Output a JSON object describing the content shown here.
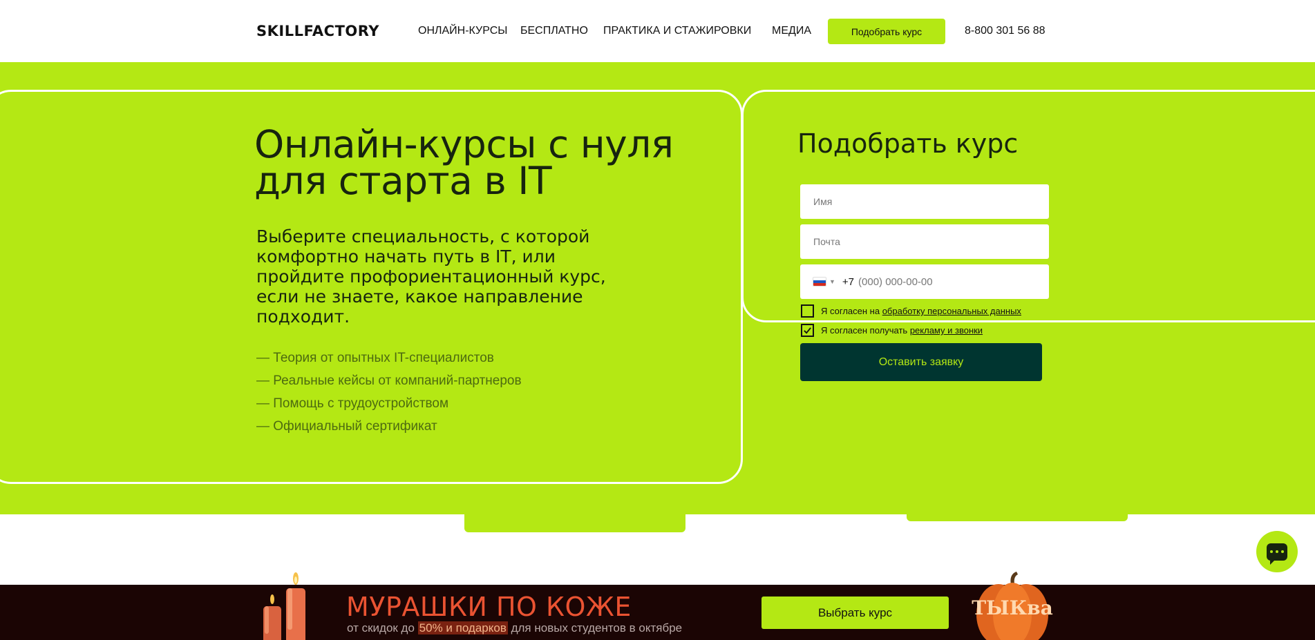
{
  "header": {
    "logo": "SKILLFACTORY",
    "nav": [
      "ОНЛАЙН-КУРСЫ",
      "БЕСПЛАТНО",
      "ПРАКТИКА И СТАЖИРОВКИ",
      "МЕДИА"
    ],
    "cta_label": "Подобрать курс",
    "phone": "8-800 301 56 88"
  },
  "hero": {
    "title": "Онлайн-курсы с нуля\nдля старта в IT",
    "subtitle": "Выберите специальность, с которой комфортно начать путь в IT, или пройдите профориентационный курс, если не знаете, какое направление подходит.",
    "features": [
      "— Теория от опытных IT-специалистов",
      "— Реальные кейсы от компаний-партнеров",
      "— Помощь с трудоустройством",
      "— Официальный сертификат"
    ]
  },
  "form": {
    "title": "Подобрать курс",
    "name_placeholder": "Имя",
    "email_placeholder": "Почта",
    "phone_prefix": "+7",
    "phone_placeholder": "(000) 000-00-00",
    "consent_1_text": "Я согласен на ",
    "consent_1_link": "обработку персональных данных",
    "consent_1_checked": false,
    "consent_2_text": "Я согласен получать ",
    "consent_2_link": "рекламу и звонки",
    "consent_2_checked": true,
    "submit_label": "Оставить заявку"
  },
  "promo": {
    "title": "МУРАШКИ ПО КОЖЕ",
    "sub_before": "от скидок до ",
    "sub_highlight": "50% и подарков",
    "sub_after": " для новых студентов в октябре",
    "button_label": "Выбрать курс",
    "pumpkin_text": "ТЫКва"
  },
  "colors": {
    "accent": "#b4e814",
    "dark_button": "#003530",
    "promo_bg": "#1b0504",
    "promo_title": "#ea5332"
  },
  "icons": {
    "chat": "chat-icon",
    "flag": "russia-flag-icon",
    "check": "checkmark-icon"
  }
}
